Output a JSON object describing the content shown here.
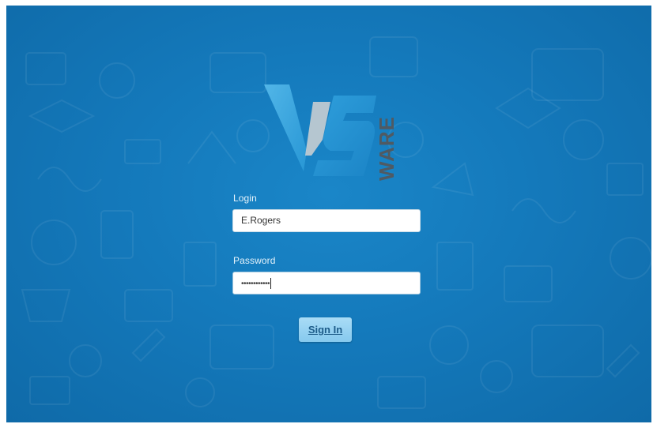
{
  "brand": {
    "logo_letters": "VS",
    "logo_side_text": "WARE"
  },
  "form": {
    "login_label": "Login",
    "login_value": "E.Rogers",
    "password_label": "Password",
    "password_mask": "••••••••••••",
    "signin_label": "Sign In"
  },
  "colors": {
    "background": "#1479bb",
    "button": "#86c9ee",
    "label": "#e6f3fb"
  }
}
